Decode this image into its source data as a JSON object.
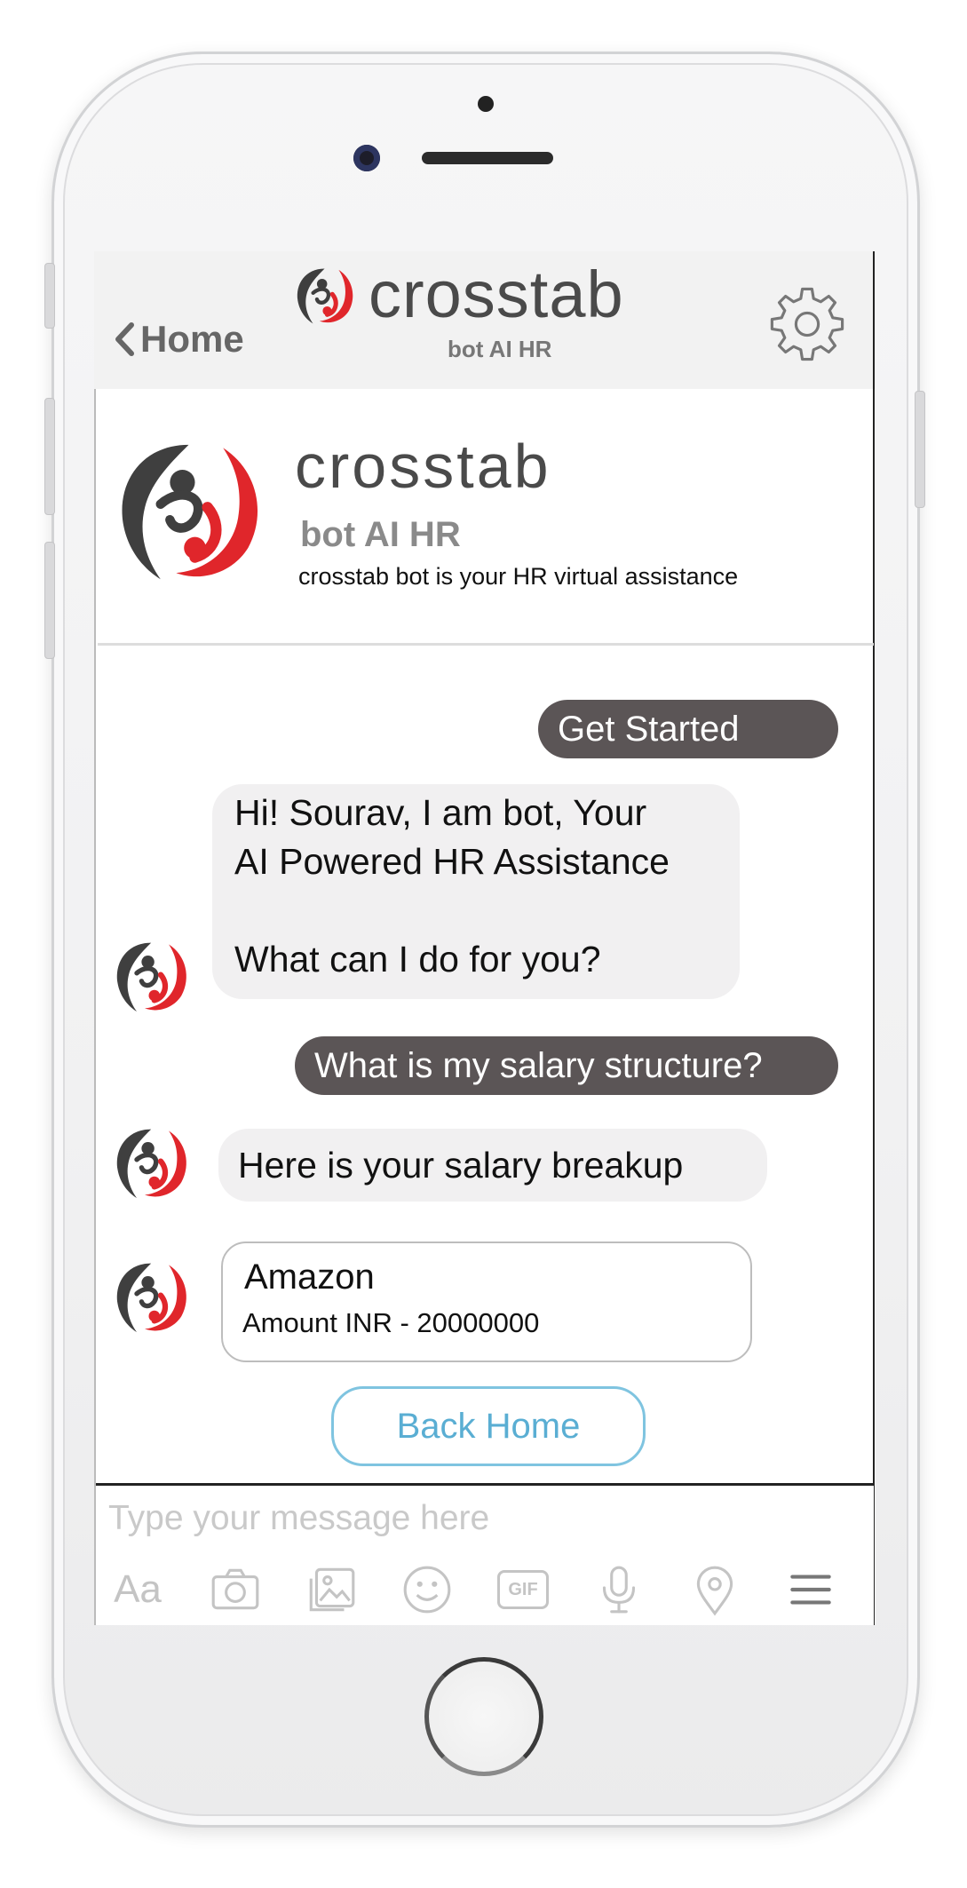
{
  "header": {
    "back_label": "Home",
    "brand_name": "crosstab",
    "brand_sub": "bot AI HR"
  },
  "profile": {
    "brand_name": "crosstab",
    "brand_sub": "bot AI HR",
    "description": "crosstab bot is your HR virtual assistance"
  },
  "messages": {
    "get_started": "Get Started",
    "bot_greeting_line1": "Hi! Sourav, I am bot, Your",
    "bot_greeting_line2": "AI Powered HR Assistance",
    "bot_greeting_line3": "What can I do for you?",
    "user_question": "What is my salary structure?",
    "bot_reply": "Here is your salary breakup",
    "card_title": "Amazon",
    "card_amount": "Amount INR - 20000000",
    "back_home": "Back Home"
  },
  "composer": {
    "placeholder": "Type your message here",
    "aa_label": "Aa",
    "gif_label": "GIF"
  },
  "icons": [
    "chevron-left-icon",
    "gear-icon",
    "crosstab-logo",
    "camera-icon",
    "gallery-icon",
    "emoji-icon",
    "gif-icon",
    "microphone-icon",
    "location-pin-icon",
    "menu-icon"
  ],
  "colors": {
    "brand_red": "#e0262b",
    "brand_dark": "#3f3f3f",
    "user_bubble": "#5b5556",
    "bot_bubble": "#f1f0f1",
    "link_blue": "#5aaed3"
  }
}
